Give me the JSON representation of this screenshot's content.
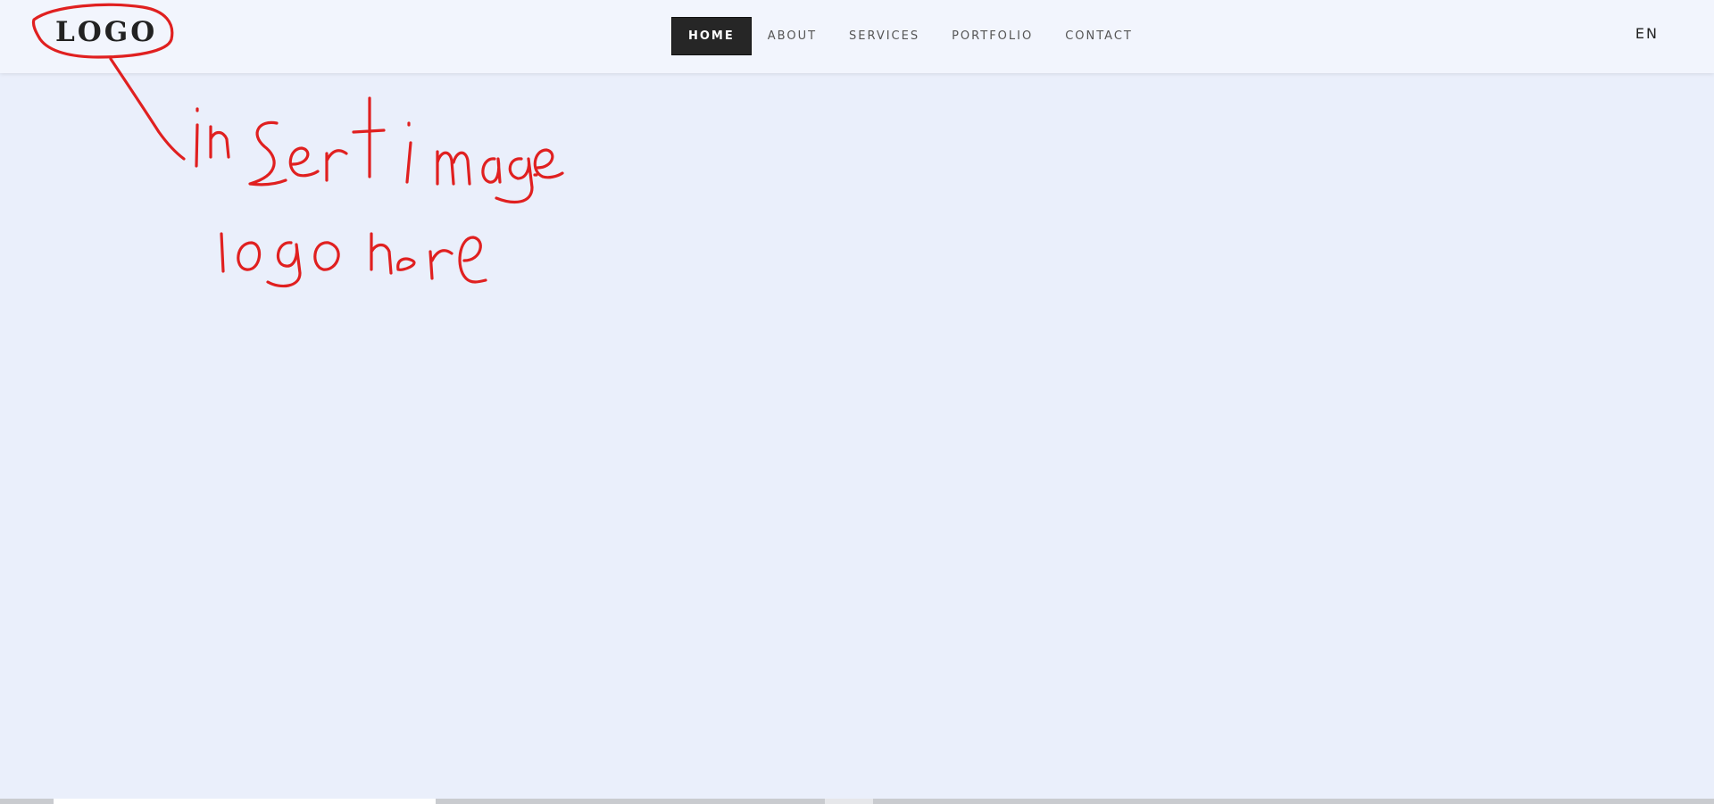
{
  "header": {
    "logo_text": "LOGO",
    "lang": "EN"
  },
  "nav": {
    "items": [
      {
        "label": "HOME",
        "active": true
      },
      {
        "label": "ABOUT",
        "active": false
      },
      {
        "label": "SERVICES",
        "active": false
      },
      {
        "label": "PORTFOLIO",
        "active": false
      },
      {
        "label": "CONTACT",
        "active": false
      }
    ]
  },
  "annotation": {
    "color": "#e02020",
    "line1": "insert image",
    "line2": "logo here"
  },
  "colors": {
    "background": "#eaeffb",
    "header_background": "#f2f5fd",
    "nav_active_background": "#262626"
  }
}
